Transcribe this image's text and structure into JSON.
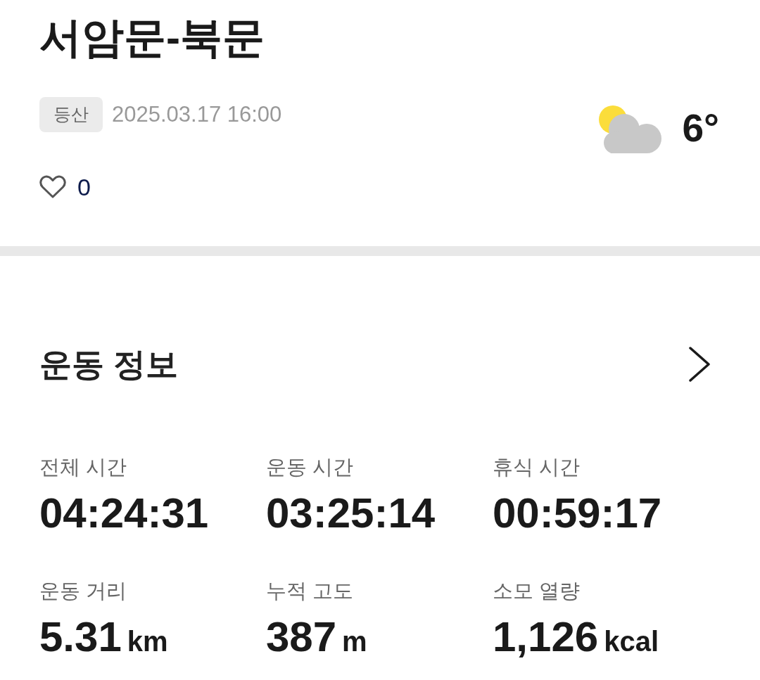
{
  "title": "서암문-북문",
  "meta": {
    "category": "등산",
    "datetime": "2025.03.17 16:00"
  },
  "like": {
    "liked": false,
    "count": "0"
  },
  "weather": {
    "kind": "partly_cloudy",
    "temperature": "6°"
  },
  "section": {
    "title": "운동 정보"
  },
  "stats": [
    {
      "label": "전체 시간",
      "value": "04:24:31"
    },
    {
      "label": "운동 시간",
      "value": "03:25:14"
    },
    {
      "label": "휴식 시간",
      "value": "00:59:17"
    },
    {
      "label": "운동 거리",
      "value": "5.31",
      "unit": "km"
    },
    {
      "label": "누적 고도",
      "value": "387",
      "unit": "m"
    },
    {
      "label": "소모 열량",
      "value": "1,126",
      "unit": "kcal"
    }
  ]
}
